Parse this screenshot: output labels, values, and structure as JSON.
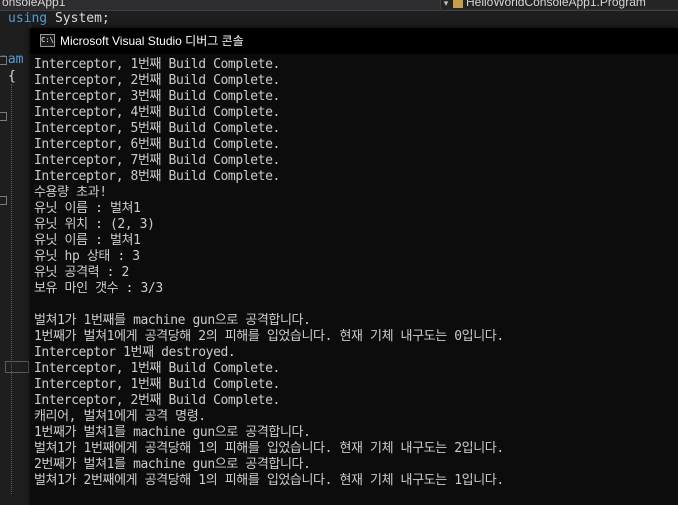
{
  "editor": {
    "left_tab": "onsoleApp1",
    "right_tab": "HelloWorldConsoleApp1.Program",
    "code_keyword_using": "using",
    "code_system": " System;",
    "code_namespace_fragment": "nam",
    "code_brace": "{"
  },
  "console": {
    "icon_label": "C:\\",
    "title": "Microsoft Visual Studio 디버그 콘솔",
    "lines": [
      "Interceptor, 1번째 Build Complete.",
      "Interceptor, 2번째 Build Complete.",
      "Interceptor, 3번째 Build Complete.",
      "Interceptor, 4번째 Build Complete.",
      "Interceptor, 5번째 Build Complete.",
      "Interceptor, 6번째 Build Complete.",
      "Interceptor, 7번째 Build Complete.",
      "Interceptor, 8번째 Build Complete.",
      "수용량 초과!",
      "유닛 이름 : 벌쳐1",
      "유닛 위치 : (2, 3)",
      "유닛 이름 : 벌쳐1",
      "유닛 hp 상태 : 3",
      "유닛 공격력 : 2",
      "보유 마인 갯수 : 3/3",
      "",
      "벌쳐1가 1번째를 machine gun으로 공격합니다.",
      "1번째가 벌쳐1에게 공격당해 2의 피해를 입었습니다. 현재 기체 내구도는 0입니다.",
      "Interceptor 1번째 destroyed.",
      "Interceptor, 1번째 Build Complete.",
      "Interceptor, 1번째 Build Complete.",
      "Interceptor, 2번째 Build Complete.",
      "캐리어, 벌쳐1에게 공격 명령.",
      "1번째가 벌쳐1를 machine gun으로 공격합니다.",
      "벌쳐1가 1번째에게 공격당해 1의 피해를 입었습니다. 현재 기체 내구도는 2입니다.",
      "2번째가 벌쳐1를 machine gun으로 공격합니다.",
      "벌쳐1가 2번째에게 공격당해 1의 피해를 입었습니다. 현재 기체 내구도는 1입니다."
    ]
  }
}
